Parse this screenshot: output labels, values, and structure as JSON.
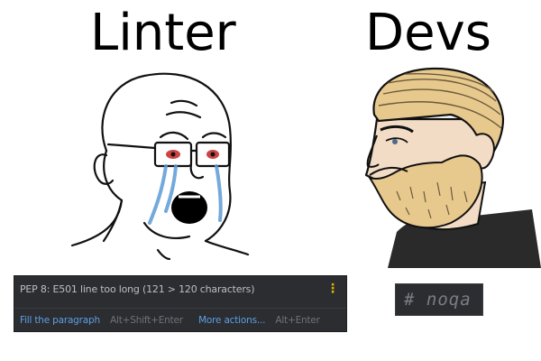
{
  "headings": {
    "left": "Linter",
    "right": "Devs"
  },
  "ide_popup": {
    "message": "PEP 8: E501 line too long (121 > 120 characters)",
    "menu_icon": "kebab-menu-icon",
    "actions": [
      {
        "label": "Fill the paragraph",
        "shortcut": "Alt+Shift+Enter"
      },
      {
        "label": "More actions...",
        "shortcut": "Alt+Enter"
      }
    ]
  },
  "suppress_comment": "# noqa",
  "colors": {
    "popup_bg": "#2b2d30",
    "link": "#5f9ee5",
    "shortcut": "#6f737a",
    "kebab": "#e0b000",
    "comment": "#7a7e85"
  }
}
